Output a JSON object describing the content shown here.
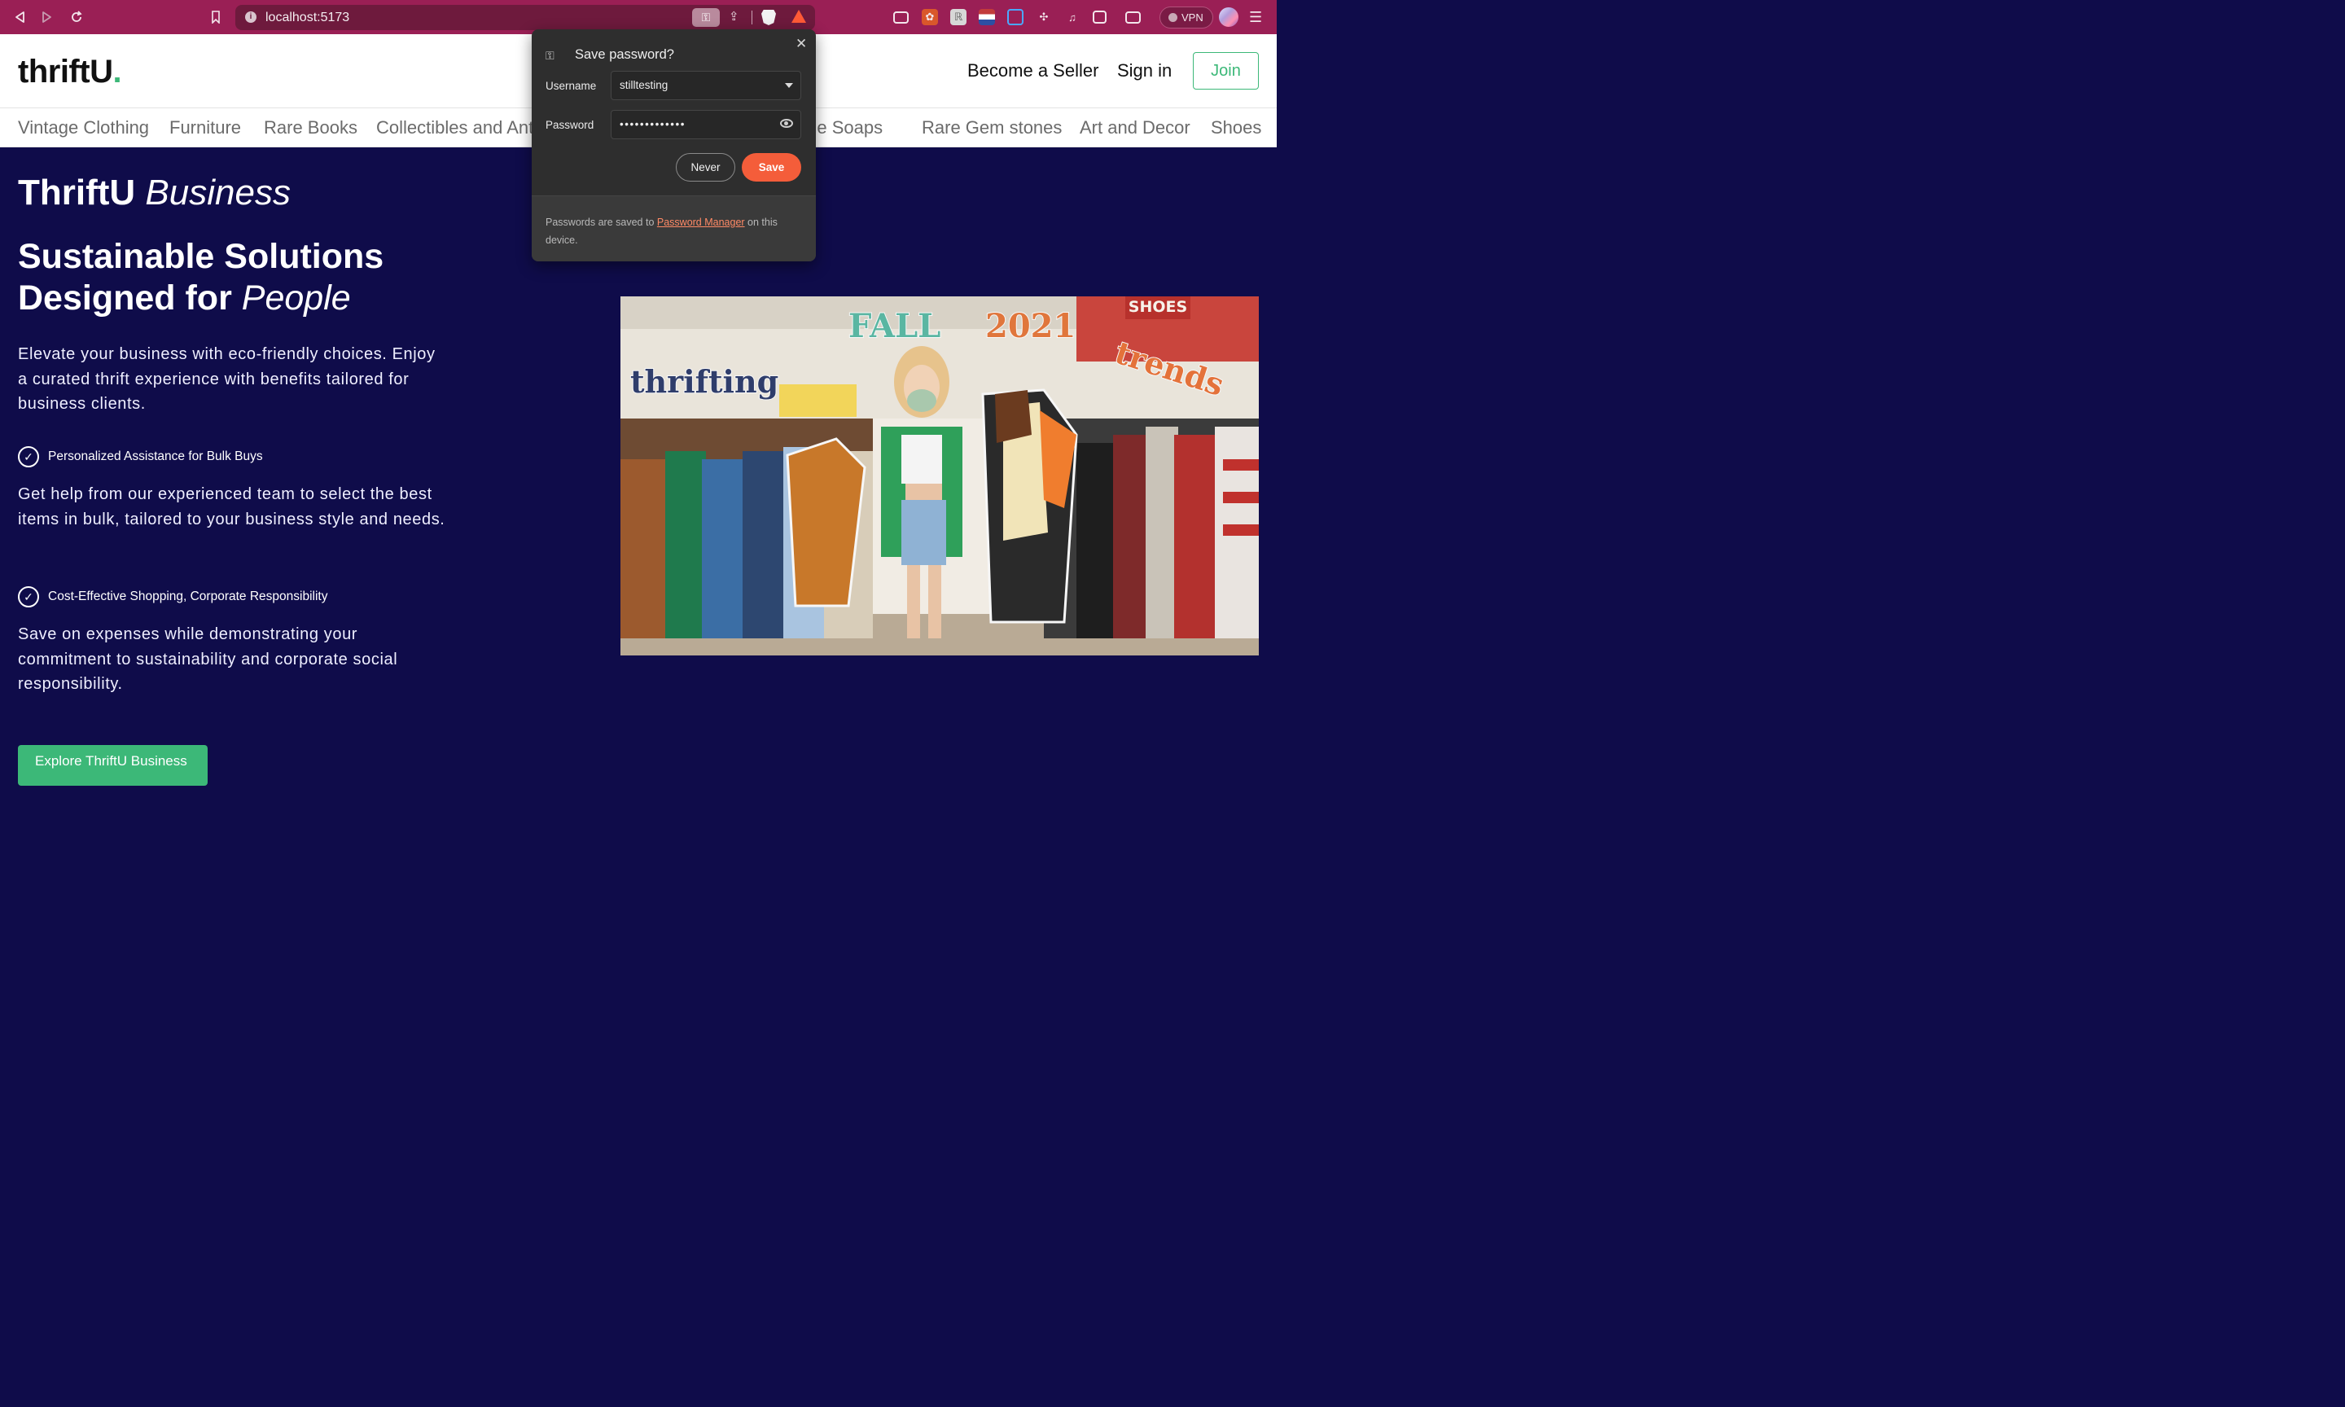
{
  "browser": {
    "url": "localhost:5173",
    "vpn_label": "VPN"
  },
  "header": {
    "logo_text": "thriftU",
    "logo_dot": ".",
    "nav": {
      "become_seller": "Become a Seller",
      "sign_in": "Sign in",
      "join": "Join"
    }
  },
  "categories": [
    "Vintage Clothing",
    "Furniture",
    "Rare Books",
    "Collectibles and Antiques",
    "Handmade Soaps",
    "Rare Gem stones",
    "Art and Decor",
    "Shoes"
  ],
  "hero": {
    "brand_strong": "ThriftU",
    "brand_italic": "Business",
    "headline_line1": "Sustainable Solutions",
    "headline_line2_strong": "Designed for",
    "headline_line2_italic": "People",
    "intro": "Elevate your business with eco-friendly choices. Enjoy a curated thrift experience with benefits tailored for business clients.",
    "features": [
      {
        "title": "Personalized Assistance for Bulk Buys",
        "description": "Get help from our experienced team to select the best items in bulk, tailored to your business style and needs."
      },
      {
        "title": "Cost-Effective Shopping, Corporate Responsibility",
        "description": "Save on expenses while demonstrating your commitment to sustainability and corporate social responsibility."
      }
    ],
    "cta_label": "Explore ThriftU Business"
  },
  "photo": {
    "overlay_word1": "thrifting",
    "overlay_word2": "FALL",
    "overlay_word3": "2021",
    "overlay_word4": "trends",
    "sign_text": "SHOES"
  },
  "password_dialog": {
    "title": "Save password?",
    "username_label": "Username",
    "username_value": "stilltesting",
    "password_label": "Password",
    "password_value": "•••••••••••••",
    "never_label": "Never",
    "save_label": "Save",
    "footer_prefix": "Passwords are saved to ",
    "footer_link": "Password Manager",
    "footer_suffix": " on this device."
  },
  "colors": {
    "toolbar": "#9a1f55",
    "page_background": "#0f0c4a",
    "brand_green": "#3cb878",
    "dialog_background": "#2e2e2e",
    "save_button": "#f45d3a"
  }
}
